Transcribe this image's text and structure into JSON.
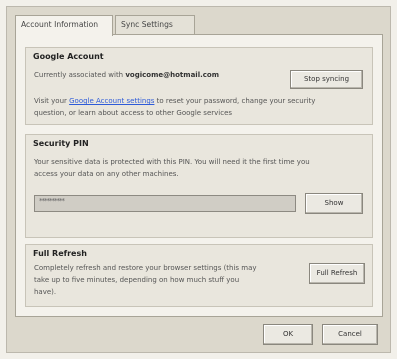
{
  "tabs": [
    {
      "label": "Account Information",
      "active": true
    },
    {
      "label": "Sync Settings",
      "active": false
    }
  ],
  "google_account": {
    "title": "Google Account",
    "line1_prefix": "Currently associated with",
    "email": "vogicome@hotmail.com",
    "stop_button": "Stop syncing",
    "visit_prefix": "Visit your ",
    "link_text": "Google Account settings",
    "visit_suffix": " to reset your password, change your security",
    "line3": "question, or learn about access to other Google services"
  },
  "security_pin": {
    "title": "Security PIN",
    "line1": "Your sensitive data is protected with this PIN. You will need it the first time you",
    "line2": "access your data on any other machines.",
    "pin_value": "**********",
    "show_button": "Show"
  },
  "full_refresh": {
    "title": "Full Refresh",
    "line1": "Completely refresh and restore your browser settings (this may",
    "line2": "take up to five minutes, depending on how much stuff you",
    "line3": "have).",
    "button": "Full Refresh"
  },
  "footer": {
    "ok": "OK",
    "cancel": "Cancel"
  }
}
